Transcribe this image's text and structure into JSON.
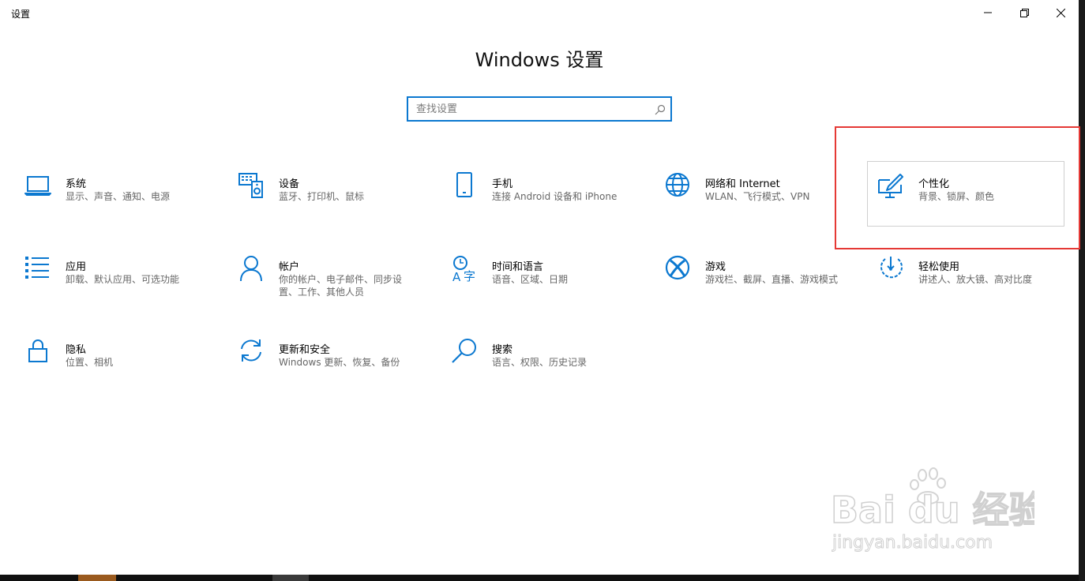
{
  "window": {
    "title": "设置",
    "controls": {
      "minimize_icon": "minimize-icon",
      "maximize_icon": "restore-icon",
      "close_icon": "close-icon"
    }
  },
  "heading": "Windows 设置",
  "search": {
    "placeholder": "查找设置",
    "value": ""
  },
  "tiles": [
    {
      "title": "系统",
      "desc": "显示、声音、通知、电源",
      "icon": "laptop-icon"
    },
    {
      "title": "设备",
      "desc": "蓝牙、打印机、鼠标",
      "icon": "devices-icon"
    },
    {
      "title": "手机",
      "desc": "连接 Android 设备和 iPhone",
      "icon": "phone-icon"
    },
    {
      "title": "网络和 Internet",
      "desc": "WLAN、飞行模式、VPN",
      "icon": "globe-icon"
    },
    {
      "title": "个性化",
      "desc": "背景、锁屏、颜色",
      "icon": "personalization-icon"
    },
    {
      "title": "应用",
      "desc": "卸载、默认应用、可选功能",
      "icon": "apps-icon"
    },
    {
      "title": "帐户",
      "desc": "你的帐户、电子邮件、同步设置、工作、其他人员",
      "icon": "person-icon"
    },
    {
      "title": "时间和语言",
      "desc": "语音、区域、日期",
      "icon": "time-language-icon"
    },
    {
      "title": "游戏",
      "desc": "游戏栏、截屏、直播、游戏模式",
      "icon": "xbox-icon"
    },
    {
      "title": "轻松使用",
      "desc": "讲述人、放大镜、高对比度",
      "icon": "ease-of-access-icon"
    },
    {
      "title": "隐私",
      "desc": "位置、相机",
      "icon": "lock-icon"
    },
    {
      "title": "更新和安全",
      "desc": "Windows 更新、恢复、备份",
      "icon": "sync-icon"
    },
    {
      "title": "搜索",
      "desc": "语言、权限、历史记录",
      "icon": "search-icon"
    }
  ],
  "watermark": {
    "brand": "Bai du 经验",
    "url": "jingyan.baidu.com"
  },
  "colors": {
    "accent": "#0b78d0",
    "highlight": "#e53935"
  }
}
